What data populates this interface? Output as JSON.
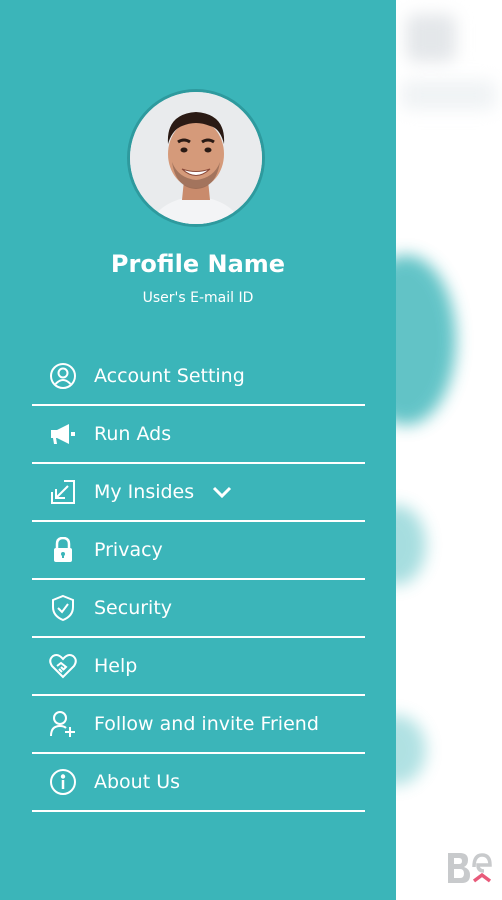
{
  "profile": {
    "name": "Profile Name",
    "email": "User's E-mail ID"
  },
  "menu": {
    "items": [
      {
        "label": "Account Setting",
        "icon": "user-circle-icon"
      },
      {
        "label": "Run Ads",
        "icon": "megaphone-icon"
      },
      {
        "label": "My Insides",
        "icon": "arrow-down-left-box-icon",
        "has_dropdown": true
      },
      {
        "label": "Privacy",
        "icon": "lock-icon"
      },
      {
        "label": "Security",
        "icon": "shield-check-icon"
      },
      {
        "label": "Help",
        "icon": "heart-handshake-icon"
      },
      {
        "label": "Follow and invite Friend",
        "icon": "user-plus-icon"
      },
      {
        "label": "About Us",
        "icon": "info-circle-icon"
      }
    ]
  },
  "colors": {
    "drawer_bg": "#3bb5b9",
    "text": "#ffffff",
    "backdrop": "#ffffff"
  },
  "watermark": {
    "icon": "behance-logo"
  }
}
